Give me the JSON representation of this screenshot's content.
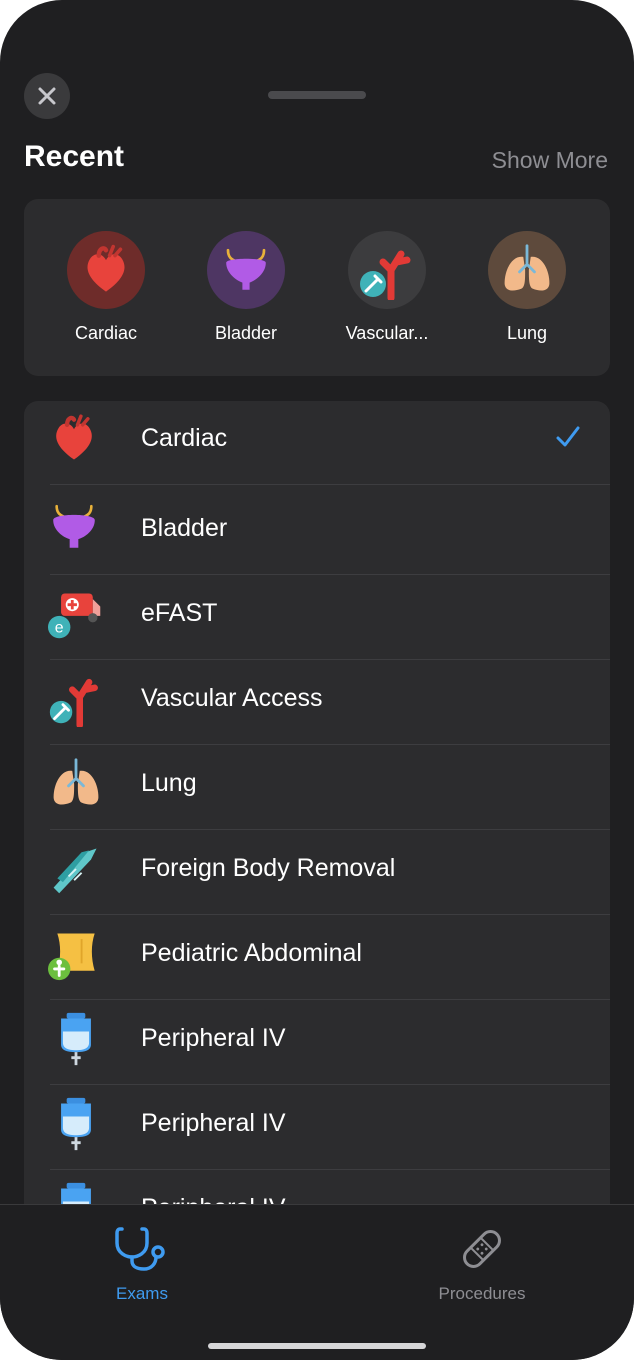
{
  "header": {
    "title": "Recent",
    "show_more": "Show More"
  },
  "recent": [
    {
      "label": "Cardiac",
      "icon": "heart-icon"
    },
    {
      "label": "Bladder",
      "icon": "bladder-icon"
    },
    {
      "label": "Vascular...",
      "icon": "vascular-access-icon"
    },
    {
      "label": "Lung",
      "icon": "lung-icon"
    }
  ],
  "exams": [
    {
      "label": "Cardiac",
      "icon": "heart-icon",
      "selected": true
    },
    {
      "label": "Bladder",
      "icon": "bladder-icon"
    },
    {
      "label": "eFAST",
      "icon": "ambulance-icon"
    },
    {
      "label": "Vascular Access",
      "icon": "vascular-access-icon"
    },
    {
      "label": "Lung",
      "icon": "lung-icon"
    },
    {
      "label": "Foreign Body Removal",
      "icon": "forceps-icon"
    },
    {
      "label": "Pediatric Abdominal",
      "icon": "pediatric-abdomen-icon"
    },
    {
      "label": "Peripheral IV",
      "icon": "iv-bag-icon"
    },
    {
      "label": "Peripheral IV",
      "icon": "iv-bag-icon"
    },
    {
      "label": "Peripheral IV",
      "icon": "iv-bag-icon"
    }
  ],
  "tabs": {
    "exams": {
      "label": "Exams",
      "icon": "stethoscope-icon",
      "active": true
    },
    "procedures": {
      "label": "Procedures",
      "icon": "bandage-icon"
    }
  },
  "colors": {
    "accent": "#3f9bf0",
    "background": "#1f1f21",
    "card": "#2c2c2e",
    "secondary_text": "#8e8e93"
  }
}
